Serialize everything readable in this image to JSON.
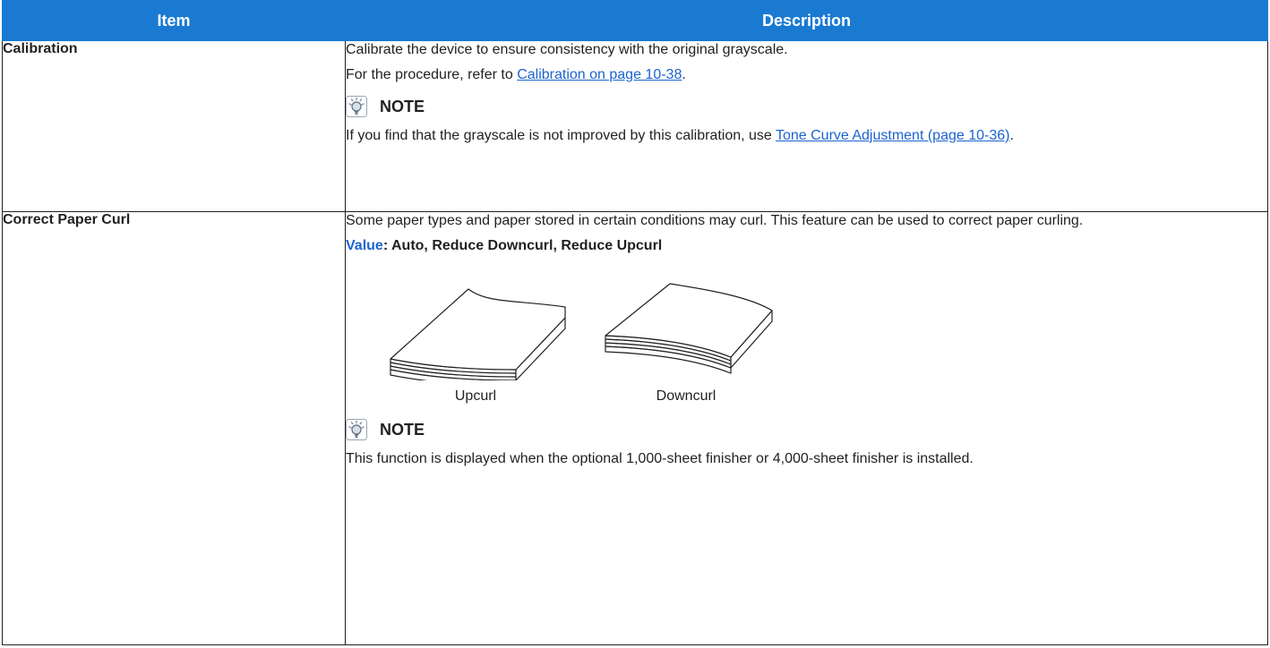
{
  "table": {
    "headers": {
      "item": "Item",
      "description": "Description"
    },
    "calibration": {
      "item": "Calibration",
      "line1": "Calibrate the device to ensure consistency with the original grayscale.",
      "line2_prefix": "For the procedure, refer to ",
      "line2_link": "Calibration on page 10-38",
      "line2_suffix": ".",
      "note_label": "NOTE",
      "note_prefix": "If you find that the grayscale is not improved by this calibration, use ",
      "note_link": "Tone Curve Adjustment (page 10-36)",
      "note_suffix": "."
    },
    "paper_curl": {
      "item": "Correct Paper Curl",
      "line1": "Some paper types and paper stored in certain conditions may curl. This feature can be used to correct paper curling.",
      "value_key": "Value",
      "value_text": ": Auto, Reduce Downcurl, Reduce Upcurl",
      "figures": {
        "upcurl": "Upcurl",
        "downcurl": "Downcurl"
      },
      "note_label": "NOTE",
      "note_text": "This function is displayed when the optional 1,000-sheet finisher or 4,000-sheet finisher is installed."
    }
  },
  "icons": {
    "note": "note-lightbulb-icon"
  },
  "colors": {
    "header_bg": "#1a7ad2",
    "link": "#1c63cf",
    "text": "#231f20"
  }
}
